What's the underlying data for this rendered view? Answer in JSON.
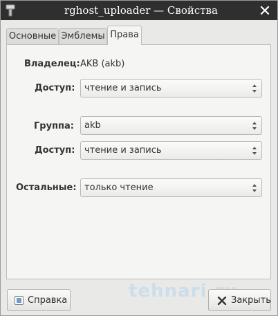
{
  "window": {
    "title": "rghost_uploader — Свойства"
  },
  "tabs": [
    {
      "label": "Основные",
      "active": false
    },
    {
      "label": "Эмблемы",
      "active": false
    },
    {
      "label": "Права",
      "active": true
    }
  ],
  "permissions": {
    "owner": {
      "label": "Владелец:",
      "value": "AKB (akb)"
    },
    "owner_access": {
      "label": "Доступ:",
      "value": "чтение и запись"
    },
    "group": {
      "label": "Группа:",
      "value": "akb"
    },
    "group_access": {
      "label": "Доступ:",
      "value": "чтение и запись"
    },
    "others": {
      "label": "Остальные:",
      "value": "только чтение"
    }
  },
  "buttons": {
    "help": "Справка",
    "close": "Закрыть"
  },
  "watermark": "tehnari.ru",
  "colors": {
    "titlebar": "#2f2f2f",
    "window_bg": "#e9e9e7",
    "panel_bg": "#f5f5f4"
  }
}
